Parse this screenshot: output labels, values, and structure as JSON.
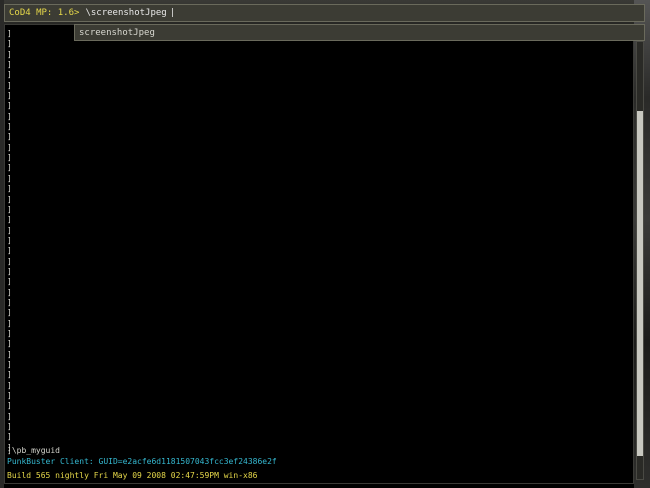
{
  "console": {
    "prompt": "CoD4 MP: 1.6>",
    "input_value": "\\screenshotJpeg",
    "cursor": "|",
    "autocomplete_suggestion": "screenshotJpeg",
    "empty_line_marker": "]",
    "empty_line_count": 41,
    "log_lines": [
      "]\\pb_myguid",
      "PunkBuster Client: GUID=e2acfe6d1181507043fcc3ef24386e2f",
      "Build 565 nightly Fri May 09 2008 02:47:59PM win-x86"
    ],
    "colors": {
      "prompt": "#e6d84a",
      "text": "#d8d8d0",
      "punkbuster": "#35b8d0",
      "build": "#e6d84a",
      "background": "#000000"
    },
    "scroll_position": 0.75
  }
}
